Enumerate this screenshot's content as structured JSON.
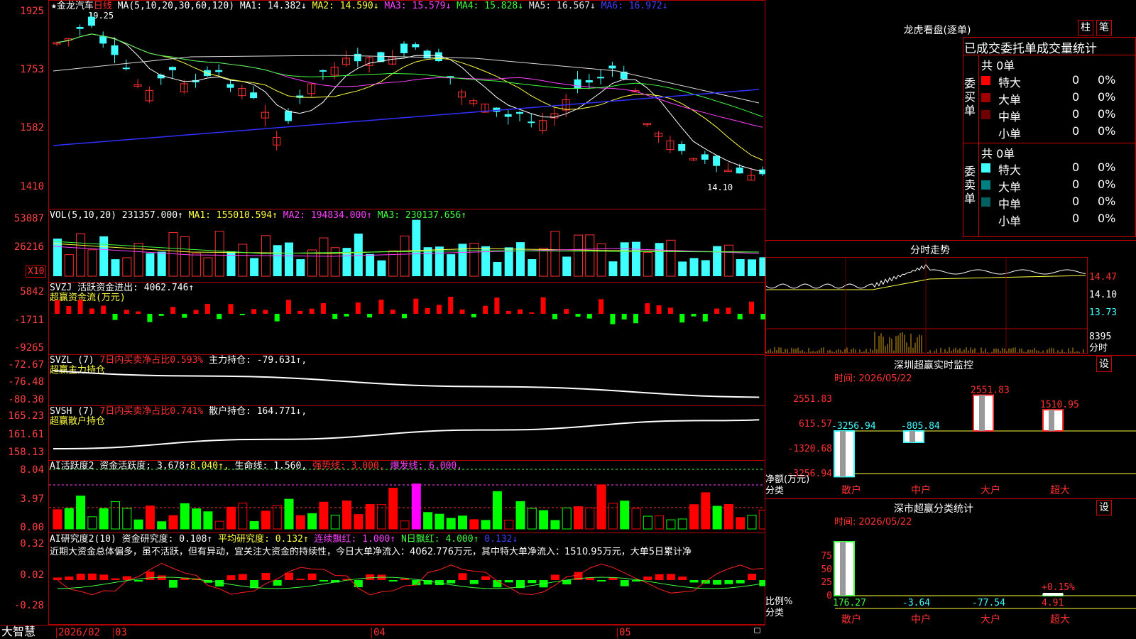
{
  "stock": {
    "name": "★金龙汽车",
    "period": "日线",
    "ma_header": "MA(5,10,20,30,60,120)",
    "ma": [
      {
        "label": "MA1: 14.382↓",
        "color": "#ffffff"
      },
      {
        "label": "MA2: 14.590↓",
        "color": "#ffff40"
      },
      {
        "label": "MA3: 15.579↓",
        "color": "#ff40ff"
      },
      {
        "label": "MA4: 15.828↓",
        "color": "#40ff40"
      },
      {
        "label": "MA5: 16.567↓",
        "color": "#e0e0e0"
      },
      {
        "label": "MA6: 16.972↓",
        "color": "#4040ff"
      }
    ],
    "high_mark": "19.25",
    "low_mark": "14.10"
  },
  "main_axis": [
    "1925",
    "1753",
    "1582",
    "1410"
  ],
  "vol": {
    "header": "VOL(5,10,20)",
    "value": "231357.000↑",
    "ma1": "MA1: 155010.594↑",
    "ma2": "MA2: 194834.000↑",
    "ma3": "MA3: 230137.656↑",
    "axis": [
      "53087",
      "26216"
    ],
    "unit": "X10"
  },
  "svzj": {
    "header": "SVZJ  活跃资金进出: 4062.746↑",
    "sub": "超赢资金流(万元)",
    "axis": [
      "5842",
      "-1711",
      "-9265"
    ]
  },
  "svzl": {
    "header": "SVZL (7)",
    "ratio": "7日内买卖净占比0.593%",
    "hold": "主力持仓: -79.631↑,",
    "sub": "超赢主力持仓",
    "axis": [
      "-72.67",
      "-76.48",
      "-80.30"
    ]
  },
  "svsh": {
    "header": "SVSH (7)",
    "ratio": "7日内买卖净占比0.741%",
    "hold": "散户持仓: 164.771↓,",
    "sub": "超赢散户持仓",
    "axis": [
      "165.23",
      "161.61",
      "158.13"
    ]
  },
  "ai1": {
    "header": "AI活跃度2 资金活跃度: 3.678↑",
    "v2": "8.040",
    "life": "生命线: 1.560",
    "strong": "强势线: 3.000",
    "burst": "爆发线: 6.000",
    "axis": [
      "8.04",
      "3.97",
      "0.00"
    ]
  },
  "ai2": {
    "header": "AI研究度2(10) 资金研究度: 0.108↑",
    "avg": "平均研究度: 0.132↑",
    "red": "连续飘红: 1.000↑",
    "nred": "N日飘红: 4.000↑",
    "last": "0.132↓",
    "axis": [
      "0.32",
      "0.02",
      "-0.28"
    ]
  },
  "commentary": "近期大资金总体偏多，虽不活跃，但有异动，宜关注大资金的持续性，今日大单净流入：4062.776万元，其中特大单净流入：1510.95万元，大单5日累计净",
  "xaxis": {
    "brand": "大智慧",
    "labels": [
      "2026/02",
      "03",
      "04",
      "05"
    ]
  },
  "dragon": {
    "title": "龙虎看盘(逐单)",
    "btn1": "柱",
    "btn2": "笔",
    "tabs": "已成交委托单成交量统计",
    "buy": {
      "label": "委买单",
      "total": "共 0单",
      "rows": [
        {
          "name": "特大",
          "v": "0",
          "p": "0%",
          "color": "#ff0000"
        },
        {
          "name": "大单",
          "v": "0",
          "p": "0%",
          "color": "#a00000"
        },
        {
          "name": "中单",
          "v": "0",
          "p": "0%",
          "color": "#700000"
        },
        {
          "name": "小单",
          "v": "0",
          "p": "0%",
          "color": "#000000"
        }
      ]
    },
    "sell": {
      "label": "委卖单",
      "total": "共 0单",
      "rows": [
        {
          "name": "特大",
          "v": "0",
          "p": "0%",
          "color": "#40ffff"
        },
        {
          "name": "大单",
          "v": "0",
          "p": "0%",
          "color": "#008080"
        },
        {
          "name": "中单",
          "v": "0",
          "p": "0%",
          "color": "#006060"
        },
        {
          "name": "小单",
          "v": "0",
          "p": "0%",
          "color": "#000000"
        }
      ]
    }
  },
  "intraday": {
    "title": "分时走势",
    "axis": [
      "14.47",
      "14.10",
      "13.73"
    ],
    "vol": "8395",
    "unit": "分时"
  },
  "sz_monitor": {
    "title": "深圳超赢实时监控",
    "set": "设",
    "time": "时间: 2026/05/22",
    "axis": [
      "2551.83",
      "615.57",
      "-1320.68",
      "-3256.94"
    ],
    "ylabel": "净额(万元)",
    "xlabel": "分类",
    "cats": [
      "散户",
      "中户",
      "大户",
      "超大"
    ],
    "values": [
      "-3256.94",
      "-805.84",
      "2551.83",
      "1510.95"
    ]
  },
  "sz_class": {
    "title": "深市超赢分类统计",
    "set": "设",
    "time": "时间: 2026/05/22",
    "axis": [
      "75",
      "50",
      "25",
      "0"
    ],
    "ylabel": "比例%",
    "xlabel": "分类",
    "cats": [
      "散户",
      "中户",
      "大户",
      "超大"
    ],
    "values": [
      "176.27",
      "-3.64",
      "-77.54",
      "4.91"
    ],
    "extra": "+0.15%"
  }
}
